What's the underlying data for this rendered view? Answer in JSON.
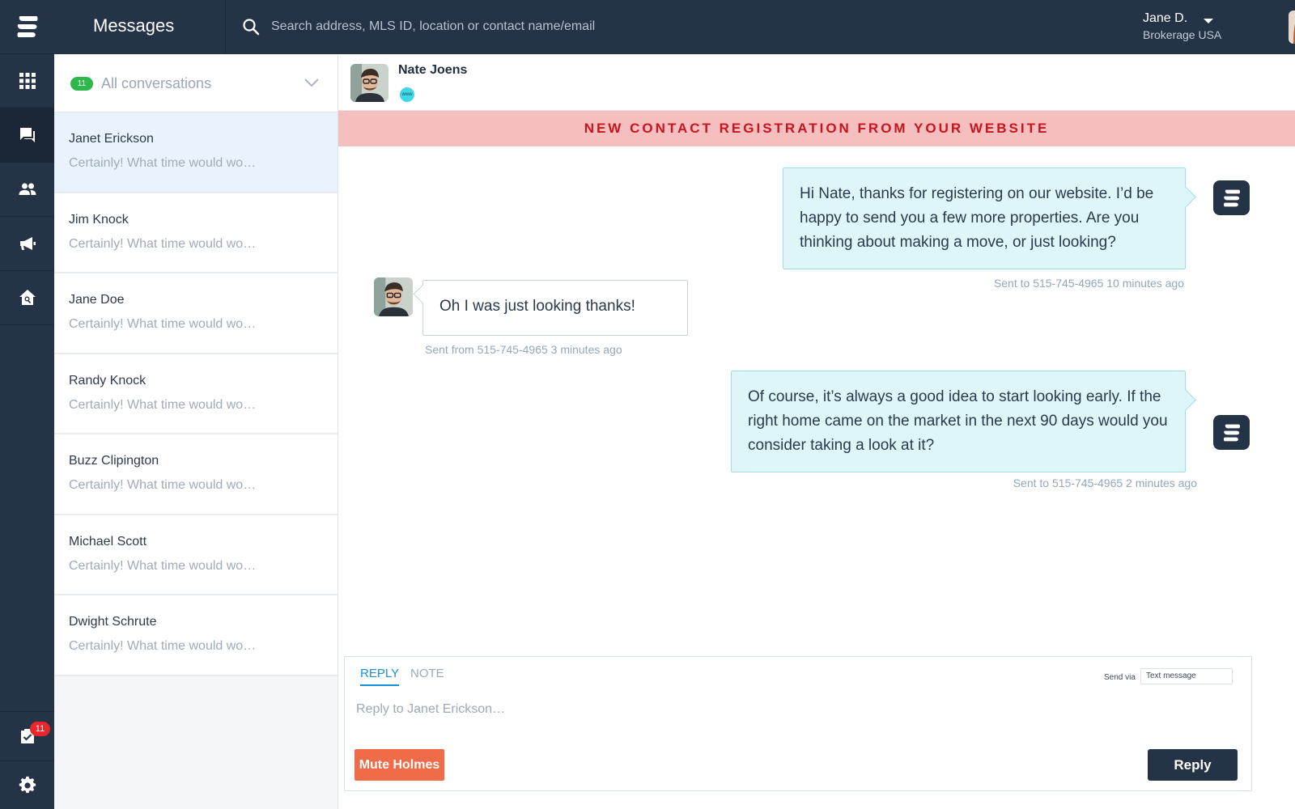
{
  "header": {
    "title": "Messages",
    "search_placeholder": "Search address, MLS ID, location or contact name/email",
    "user": {
      "name": "Jane D.",
      "org": "Brokerage USA"
    }
  },
  "rail": {
    "items": [
      {
        "icon": "grid-icon"
      },
      {
        "icon": "chat-icon",
        "active": true
      },
      {
        "icon": "people-icon"
      },
      {
        "icon": "megaphone-icon"
      },
      {
        "icon": "house-search-icon"
      }
    ],
    "tasks_badge": "11",
    "bottom_icons": [
      "tasks-icon",
      "gear-icon"
    ]
  },
  "conversations": {
    "count": "11",
    "filter": "All conversations",
    "items": [
      {
        "name": "Janet Erickson",
        "preview": "Certainly! What time would wo…",
        "selected": true
      },
      {
        "name": "Jim Knock",
        "preview": "Certainly! What time would wo…"
      },
      {
        "name": "Jane Doe",
        "preview": "Certainly! What time would wo…"
      },
      {
        "name": "Randy Knock",
        "preview": "Certainly! What time would wo…"
      },
      {
        "name": "Buzz Clipington",
        "preview": "Certainly! What time would wo…"
      },
      {
        "name": "Michael Scott",
        "preview": "Certainly! What time would wo…"
      },
      {
        "name": "Dwight Schrute",
        "preview": "Certainly! What time would wo…"
      }
    ]
  },
  "chat": {
    "contact_name": "Nate Joens",
    "source_icon_text": "www",
    "banner": "NEW CONTACT REGISTRATION FROM YOUR WEBSITE",
    "messages": [
      {
        "direction": "out",
        "text": "Hi Nate, thanks for registering on our website. I’d be happy to send you a few more properties. Are you thinking about making a move, or just looking?",
        "meta": "Sent to 515-745-4965 10 minutes ago"
      },
      {
        "direction": "in",
        "text": "Oh I was just looking thanks!",
        "meta": "Sent from 515-745-4965 3 minutes ago"
      },
      {
        "direction": "out",
        "text": "Of course, it’s always a good idea to start looking early. If the right home came on the market in the next 90 days would you consider taking a look at it?",
        "meta": "Sent to 515-745-4965 2 minutes ago"
      }
    ]
  },
  "composer": {
    "tab_reply": "REPLY",
    "tab_note": "NOTE",
    "send_via_label": "Send via",
    "send_via_value": "Text message",
    "placeholder": "Reply to Janet Erickson…",
    "mute_label": "Mute Holmes",
    "reply_label": "Reply"
  },
  "colors": {
    "nav_bg": "#253347",
    "banner_bg": "#f5bfbf",
    "banner_text": "#c8141e",
    "bubble_bg": "#dff6f8",
    "badge_green": "#2db84c",
    "mute_orange": "#f06b48",
    "accent_blue": "#1a8fd8"
  }
}
